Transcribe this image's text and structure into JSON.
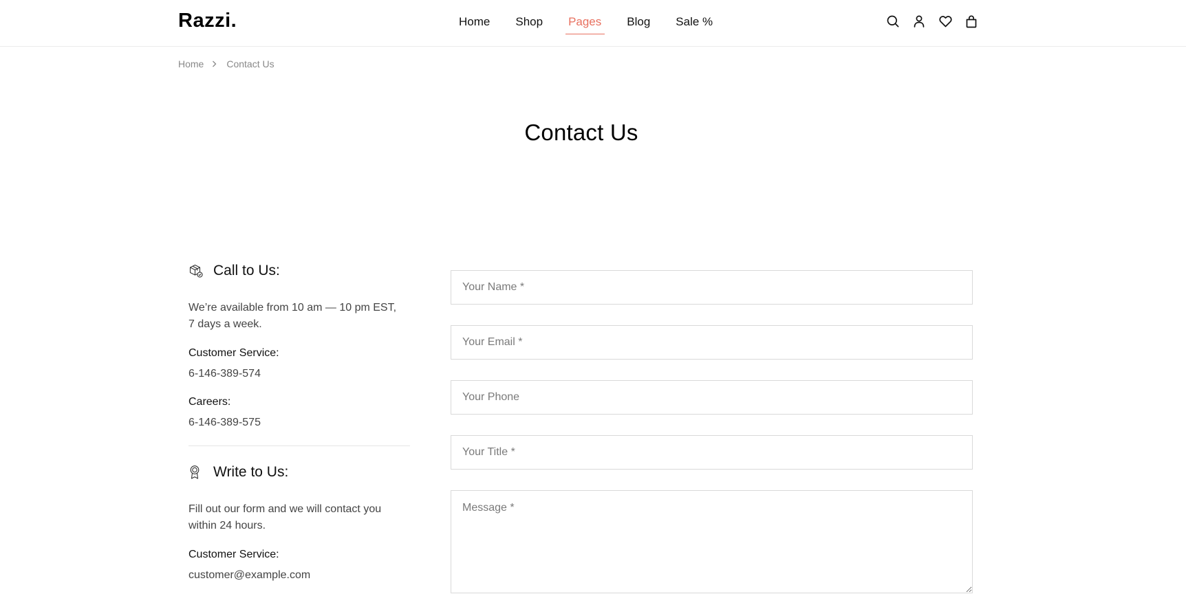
{
  "brand": {
    "logo_text": "Razzi."
  },
  "nav": {
    "items": [
      {
        "label": "Home"
      },
      {
        "label": "Shop"
      },
      {
        "label": "Pages"
      },
      {
        "label": "Blog"
      },
      {
        "label": "Sale %"
      }
    ],
    "active_item": "Pages",
    "accent_color": "#e8705f"
  },
  "header_icons": [
    "search-icon",
    "user-icon",
    "heart-icon",
    "shopping-bag-icon"
  ],
  "breadcrumb": {
    "home": "Home",
    "current": "Contact Us"
  },
  "page": {
    "title": "Contact Us"
  },
  "call": {
    "heading": "Call to Us:",
    "availability_line1": "We’re available from 10 am — 10 pm EST,",
    "availability_line2": "7 days a week.",
    "customer_service_label": "Customer Service:",
    "customer_service_value": "6-146-389-574",
    "careers_label": "Careers:",
    "careers_value": "6-146-389-575"
  },
  "write": {
    "heading": "Write to Us:",
    "text_line1": "Fill out our form and we will contact you",
    "text_line2": "within 24 hours.",
    "customer_service_label": "Customer Service:",
    "customer_service_value": "customer@example.com"
  },
  "form": {
    "name_placeholder": "Your Name *",
    "email_placeholder": "Your Email *",
    "phone_placeholder": "Your Phone",
    "title_placeholder": "Your Title *",
    "message_placeholder": "Message *"
  }
}
